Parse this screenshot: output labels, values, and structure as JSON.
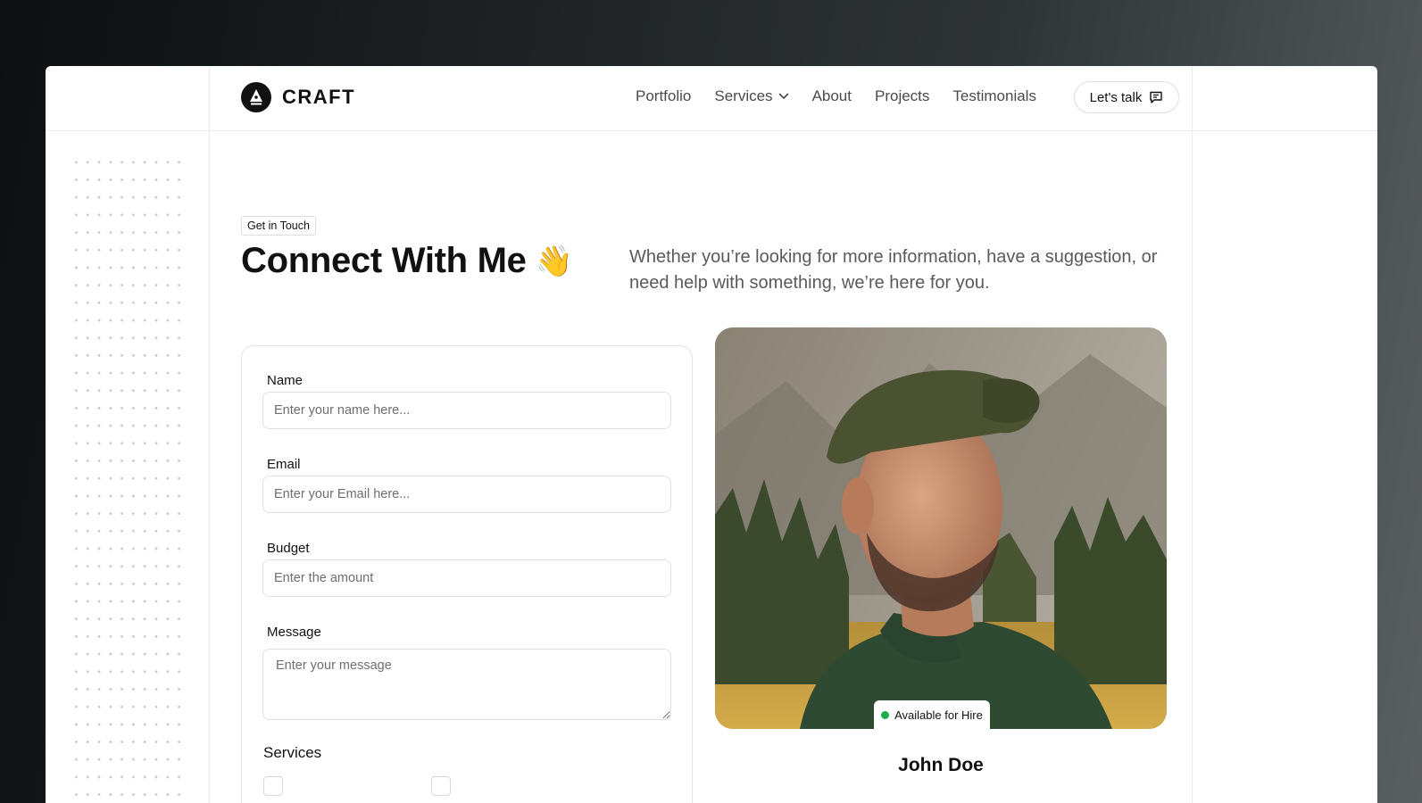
{
  "brand": {
    "name": "CRAFT"
  },
  "nav": {
    "items": [
      {
        "label": "Portfolio"
      },
      {
        "label": "Services",
        "has_dropdown": true
      },
      {
        "label": "About"
      },
      {
        "label": "Projects"
      },
      {
        "label": "Testimonials"
      }
    ],
    "cta_label": "Let's talk"
  },
  "hero": {
    "tag": "Get in Touch",
    "title": "Connect With Me",
    "title_emoji": "👋",
    "lead": "Whether you’re looking for more information, have a suggestion, or need help with something, we’re here for you."
  },
  "form": {
    "name": {
      "label": "Name",
      "placeholder": "Enter your name here..."
    },
    "email": {
      "label": "Email",
      "placeholder": "Enter your Email here..."
    },
    "budget": {
      "label": "Budget",
      "placeholder": "Enter the amount"
    },
    "message": {
      "label": "Message",
      "placeholder": "Enter your message"
    },
    "services_title": "Services"
  },
  "profile": {
    "availability": "Available for Hire",
    "name": "John Doe"
  },
  "colors": {
    "accent_dark": "#111111",
    "available_dot": "#1bae4b"
  },
  "icons": [
    "logo-pen-icon",
    "chevron-down-icon",
    "chat-bubble-icon"
  ]
}
